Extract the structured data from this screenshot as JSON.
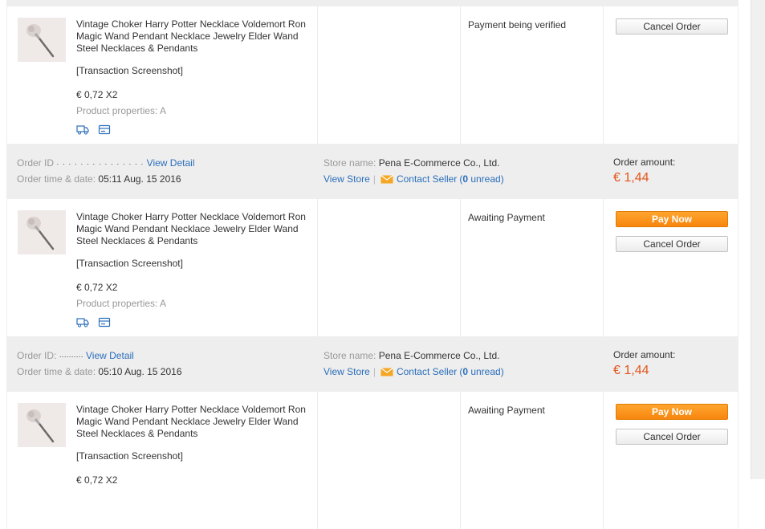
{
  "colors": {
    "accent_link": "#2a6ebb",
    "price_red": "#e4541c",
    "pay_orange": "#f7860e",
    "header_bg": "#eeeeee"
  },
  "orders": [
    {
      "product": {
        "name": "Vintage Choker Harry Potter Necklace Voldemort Ron Magic Wand Pendant Necklace Jewelry Elder Wand Steel Necklaces & Pendants",
        "screenshot_label": "[Transaction Screenshot]",
        "price_qty": "€ 0,72 X2",
        "properties": "Product properties: A"
      },
      "status": "Payment being verified",
      "buttons": {
        "cancel": "Cancel Order"
      }
    },
    {
      "header": {
        "order_id_label": "Order ID",
        "order_id_value": "· · · · · ·  · · ·     · · · · · ·",
        "view_detail": "View Detail",
        "order_time_label": "Order time & date:",
        "order_time_value": "05:11 Aug. 15 2016",
        "store_name_label": "Store name:",
        "store_name_value": "Pena E-Commerce Co., Ltd.",
        "view_store": "View Store",
        "contact_seller": "Contact Seller",
        "unread_prefix": "(",
        "unread_count": "0",
        "unread_suffix": " unread)",
        "amount_label": "Order amount:",
        "amount_value": "€ 1,44"
      },
      "product": {
        "name": "Vintage Choker Harry Potter Necklace Voldemort Ron Magic Wand Pendant Necklace Jewelry Elder Wand Steel Necklaces & Pendants",
        "screenshot_label": "[Transaction Screenshot]",
        "price_qty": "€ 0,72 X2",
        "properties": "Product properties: A"
      },
      "status": "Awaiting Payment",
      "buttons": {
        "pay": "Pay Now",
        "cancel": "Cancel Order"
      }
    },
    {
      "header": {
        "order_id_label": "Order ID:",
        "order_id_value": "··········",
        "view_detail": "View Detail",
        "order_time_label": "Order time & date:",
        "order_time_value": "05:10 Aug. 15 2016",
        "store_name_label": "Store name:",
        "store_name_value": "Pena E-Commerce Co., Ltd.",
        "view_store": "View Store",
        "contact_seller": "Contact Seller",
        "unread_prefix": "(",
        "unread_count": "0",
        "unread_suffix": " unread)",
        "amount_label": "Order amount:",
        "amount_value": "€ 1,44"
      },
      "product": {
        "name": "Vintage Choker Harry Potter Necklace Voldemort Ron Magic Wand Pendant Necklace Jewelry Elder Wand Steel Necklaces & Pendants",
        "screenshot_label": "[Transaction Screenshot]",
        "price_qty": "€ 0,72 X2"
      },
      "status": "Awaiting Payment",
      "buttons": {
        "pay": "Pay Now",
        "cancel": "Cancel Order"
      }
    }
  ]
}
